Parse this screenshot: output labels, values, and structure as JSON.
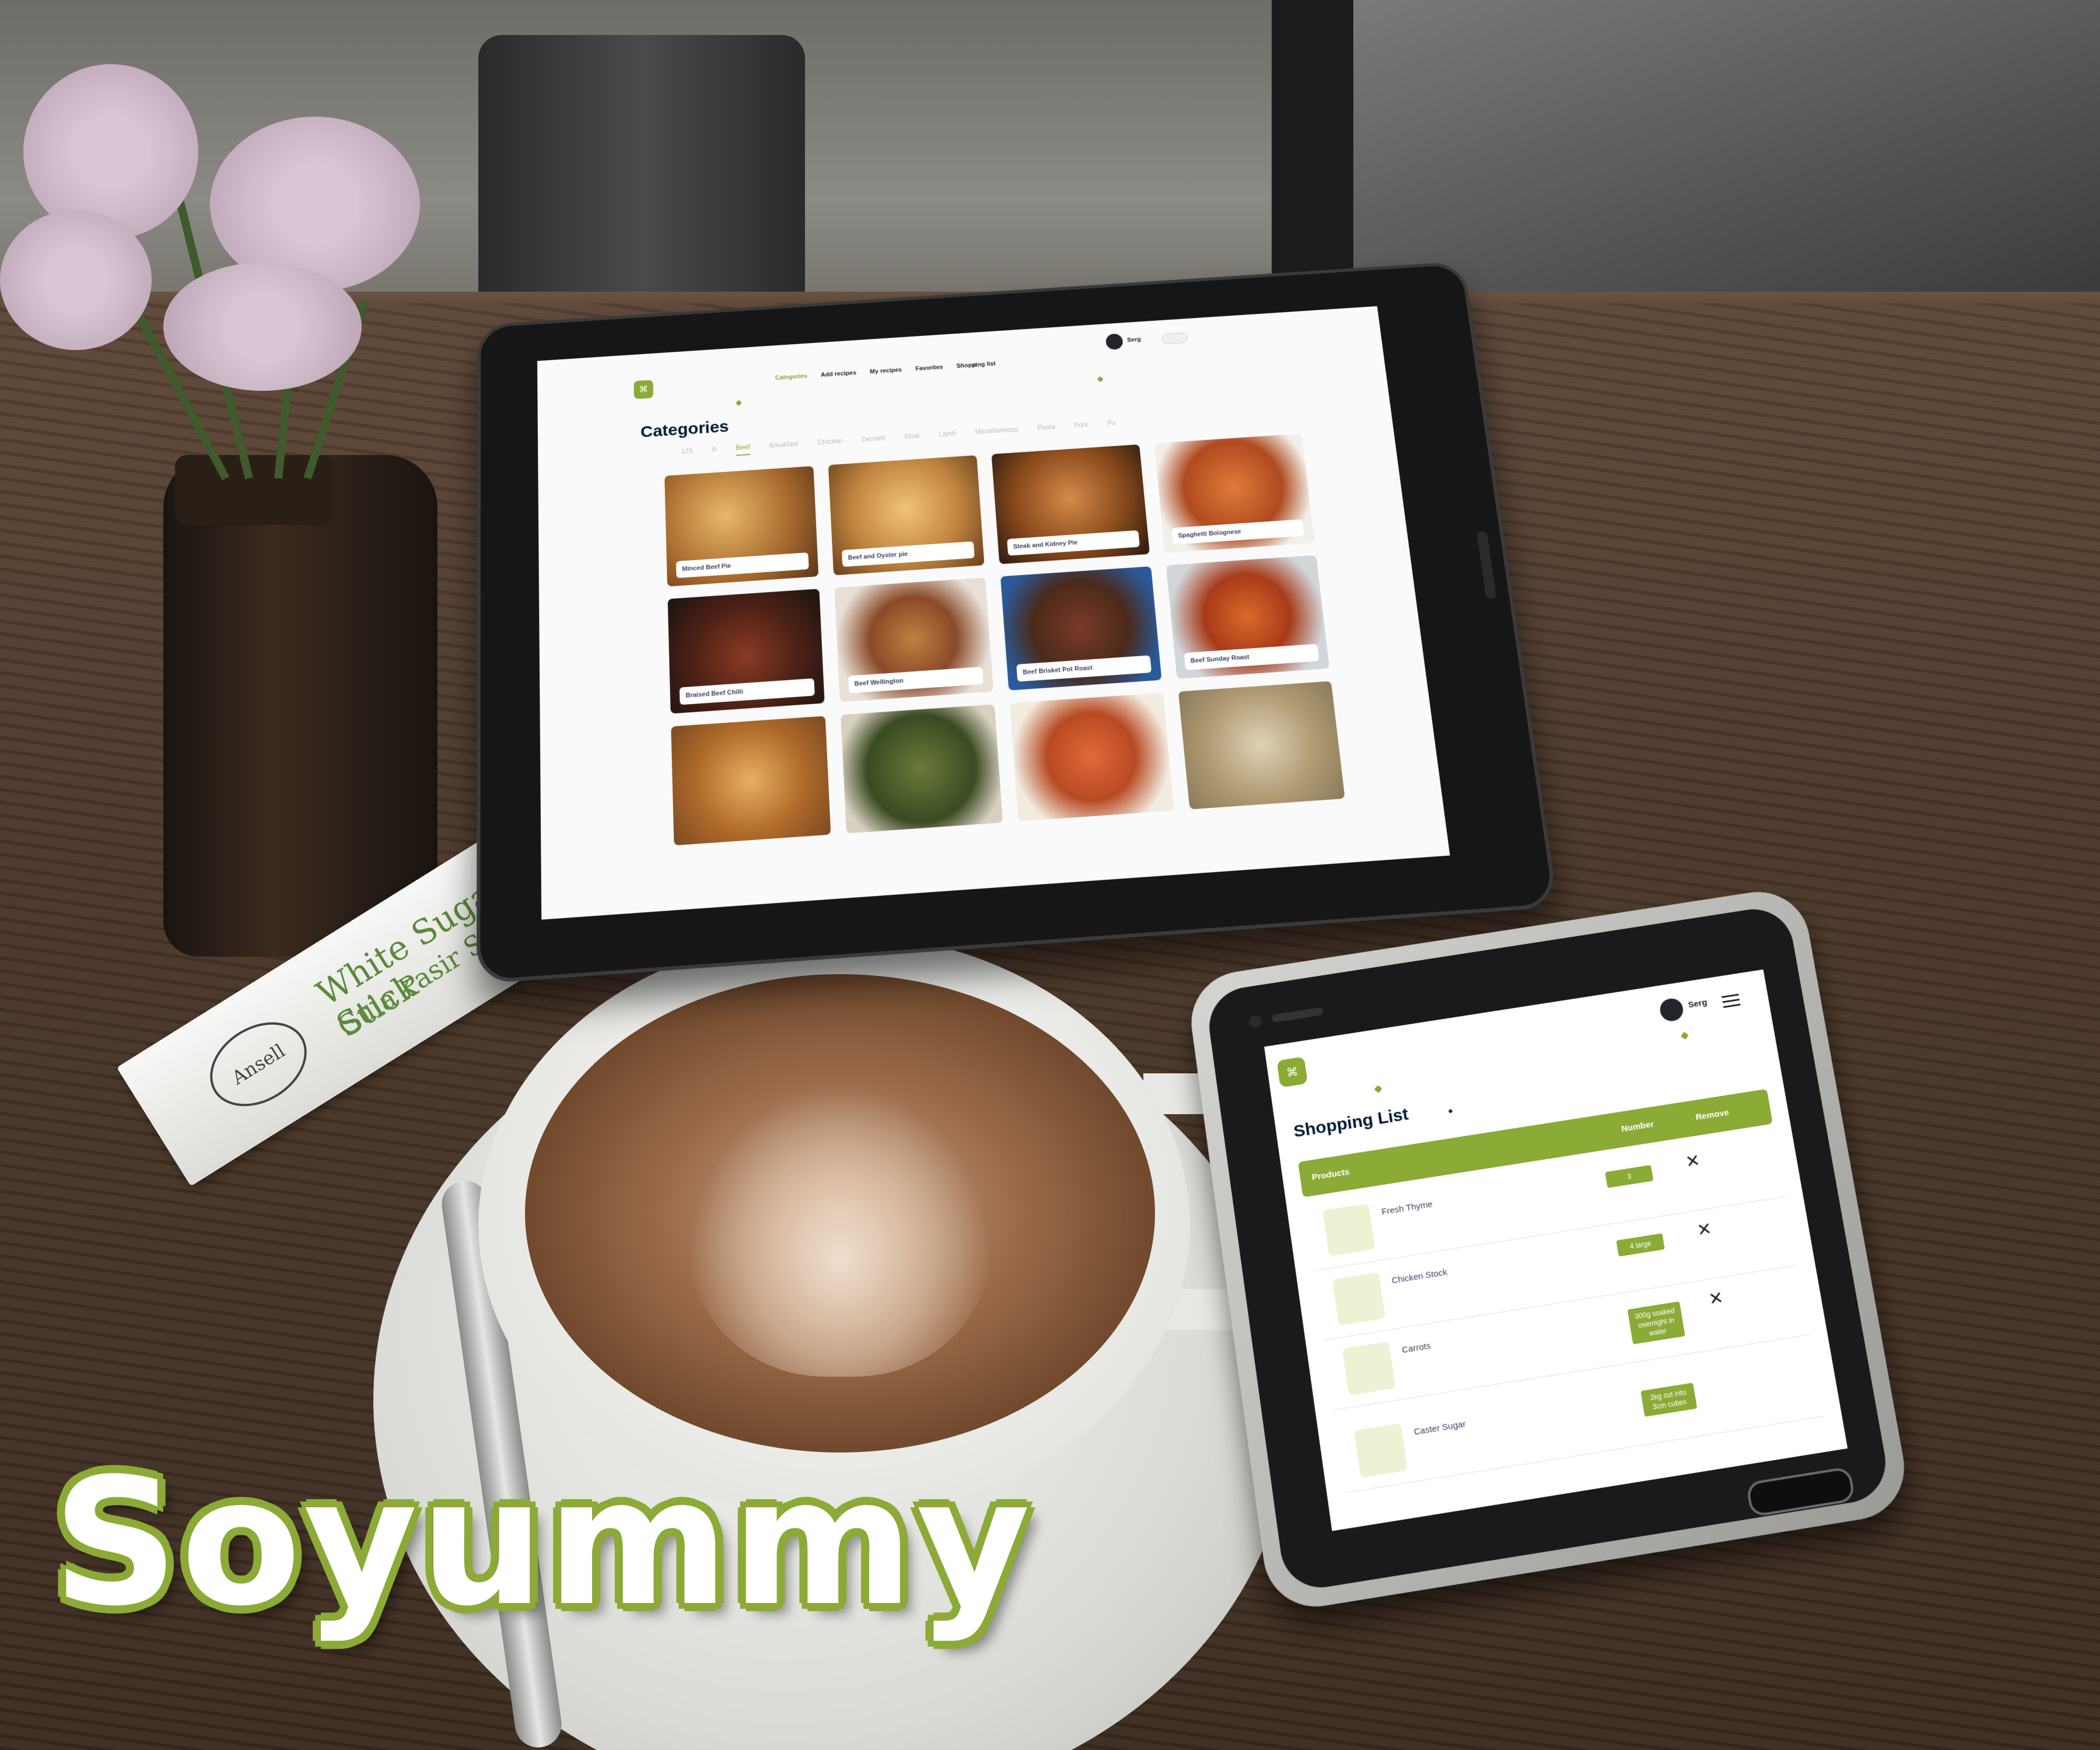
{
  "brand": {
    "name": "Soyummy",
    "accent": "#8baa36"
  },
  "sugar": {
    "line1": "White Sugar Stick",
    "line2": "Gula Pasir Stik",
    "logo": "Ansell"
  },
  "tablet": {
    "logo_icon": "logo-icon",
    "nav": [
      "Categories",
      "Add recipes",
      "My recipes",
      "Favorites",
      "Shopping list"
    ],
    "user": "Serg",
    "title": "Categories",
    "tabs": [
      "123",
      "ili",
      "Beef",
      "Breakfast",
      "Chicken",
      "Dessert",
      "Goat",
      "Lamb",
      "Miscellaneous",
      "Pasta",
      "Pork",
      "Pu"
    ],
    "active_tab": "Beef",
    "cards": [
      {
        "label": "Minced Beef Pie"
      },
      {
        "label": "Beef and Oyster pie"
      },
      {
        "label": "Steak and Kidney Pie"
      },
      {
        "label": "Spaghetti Bolognese"
      },
      {
        "label": "Braised Beef Chilli"
      },
      {
        "label": "Beef Wellington"
      },
      {
        "label": "Beef Brisket Pot Roast"
      },
      {
        "label": "Beef Sunday Roast"
      },
      {
        "label": ""
      },
      {
        "label": ""
      },
      {
        "label": ""
      },
      {
        "label": ""
      }
    ]
  },
  "phone": {
    "user": "Serg",
    "title": "Shopping List",
    "table": {
      "products": "Products",
      "number": "Number",
      "remove": "Remove"
    },
    "items": [
      {
        "name": "Fresh Thyme",
        "qty": "3"
      },
      {
        "name": "Chicken Stock",
        "qty": "4 large"
      },
      {
        "name": "Carrots",
        "qty": "300g soaked overnight in water"
      },
      {
        "name": "Caster Sugar",
        "qty": "2kg cut into 3cm cubes"
      }
    ],
    "remove_glyph": "✕"
  }
}
